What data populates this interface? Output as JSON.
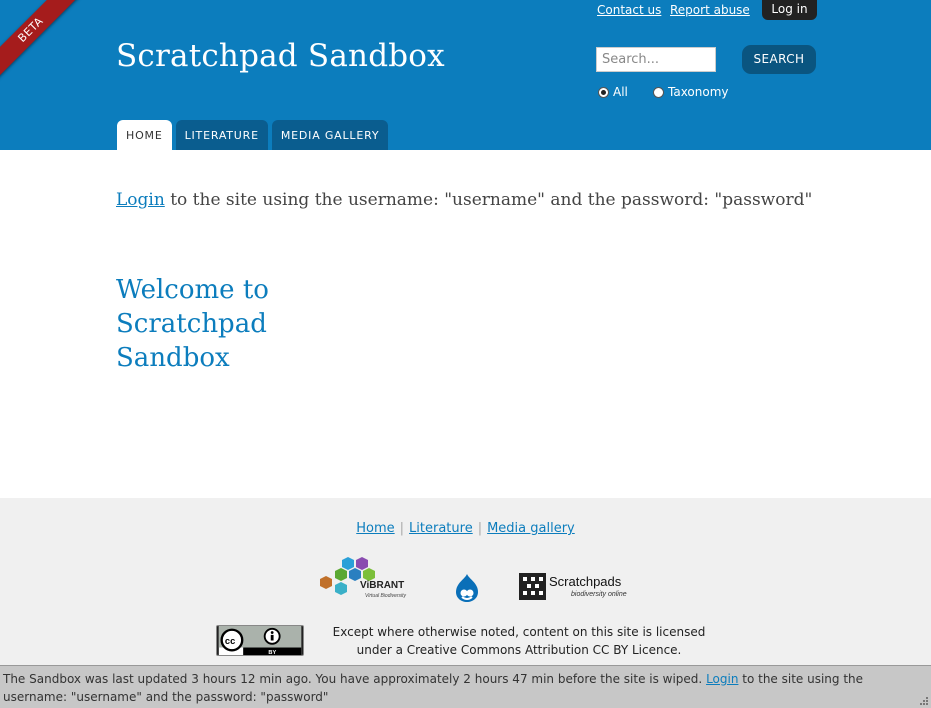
{
  "header": {
    "beta_ribbon": "BETA",
    "site_title": "Scratchpad Sandbox",
    "contact_link": "Contact us",
    "report_link": "Report abuse",
    "login_button": "Log in",
    "search": {
      "placeholder": "Search...",
      "button": "SEARCH"
    },
    "radio_all": "All",
    "radio_taxonomy": "Taxonomy",
    "tabs": [
      {
        "label": "HOME",
        "active": true
      },
      {
        "label": "LITERATURE",
        "active": false
      },
      {
        "label": "MEDIA GALLERY",
        "active": false
      }
    ],
    "colors": {
      "header_bg": "#0c7dbd",
      "accent": "#0c7dbd",
      "ribbon": "#a51c1c"
    }
  },
  "main": {
    "intro_link": "Login",
    "intro_text": " to the site using the username: \"username\" and the password: \"password\"",
    "welcome": "Welcome to Scratchpad Sandbox"
  },
  "footer": {
    "nav": [
      "Home",
      "Literature",
      "Media gallery"
    ],
    "vibrant_name": "ViBRANT",
    "vibrant_tagline": "Virtual Biodiversity",
    "scratchpads_name": "Scratchpads",
    "scratchpads_tagline": "biodiversity online",
    "cc_badge_text": "BY",
    "licence_line1": "Except where otherwise noted, content on this site is licensed",
    "licence_line2": "under a Creative Commons Attribution CC BY Licence."
  },
  "status": {
    "text_before": "The Sandbox was last updated 3 hours 12 min ago. You have approximately 2 hours 47 min before the site is wiped. ",
    "login_link": "Login",
    "text_after": " to the site using the username: \"username\" and the password: \"password\""
  }
}
